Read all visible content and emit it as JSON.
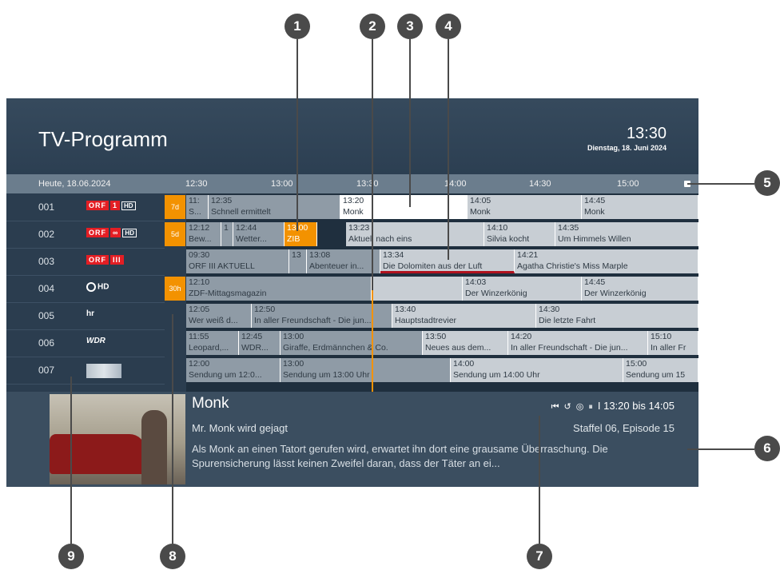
{
  "header": {
    "title": "TV-Programm",
    "clock": "13:30",
    "date": "Dienstag, 18. Juni 2024"
  },
  "timeline": {
    "day": "Heute, 18.06.2024",
    "ticks": [
      "12:30",
      "13:00",
      "13:30",
      "14:00",
      "14:30",
      "15:00"
    ]
  },
  "channels": [
    {
      "num": "001",
      "logo_main": "ORF",
      "logo_extra": "1",
      "logo_hd": "HD",
      "replay": "7d"
    },
    {
      "num": "002",
      "logo_main": "ORF",
      "logo_extra": "∞",
      "logo_hd": "HD",
      "replay": "5d"
    },
    {
      "num": "003",
      "logo_main": "ORF",
      "logo_extra": "III",
      "logo_hd": "",
      "replay": ""
    },
    {
      "num": "004",
      "logo_main": "HD",
      "logo_extra": "",
      "logo_hd": "",
      "replay": "30h"
    },
    {
      "num": "005",
      "logo_main": "hr",
      "logo_extra": "",
      "logo_hd": "",
      "replay": ""
    },
    {
      "num": "006",
      "logo_main": "WDR",
      "logo_extra": "",
      "logo_hd": "",
      "replay": ""
    },
    {
      "num": "007",
      "logo_main": "",
      "logo_extra": "",
      "logo_hd": "",
      "replay": ""
    }
  ],
  "grid": {
    "rows": [
      [
        {
          "t": "11:",
          "n": "S...",
          "style": "past"
        },
        {
          "t": "12:35",
          "n": "Schnell ermittelt",
          "style": "past"
        },
        {
          "t": "13:20",
          "n": "Monk",
          "style": "sel"
        },
        {
          "t": "",
          "n": "",
          "style": "sel"
        },
        {
          "t": "14:05",
          "n": "Monk",
          "style": ""
        },
        {
          "t": "14:45",
          "n": "Monk",
          "style": ""
        }
      ],
      [
        {
          "t": "12:12",
          "n": "Bew...",
          "style": "past"
        },
        {
          "t": "1",
          "n": "",
          "style": "past"
        },
        {
          "t": "12:44",
          "n": "Wetter...",
          "style": "past"
        },
        {
          "t": "13:00",
          "n": "ZIB",
          "style": "orange"
        },
        {
          "t": "13:23",
          "n": "Aktuell nach eins",
          "style": ""
        },
        {
          "t": "14:10",
          "n": "Silvia kocht",
          "style": ""
        },
        {
          "t": "14:35",
          "n": "Um Himmels Willen",
          "style": ""
        }
      ],
      [
        {
          "t": "09:30",
          "n": "ORF III AKTUELL",
          "style": "past"
        },
        {
          "t": "13",
          "n": "",
          "style": "past"
        },
        {
          "t": "13:08",
          "n": "Abenteuer in...",
          "style": "past"
        },
        {
          "t": "13:34",
          "n": "Die Dolomiten aus der Luft",
          "style": "redline"
        },
        {
          "t": "14:21",
          "n": "Agatha Christie's Miss Marple",
          "style": ""
        }
      ],
      [
        {
          "t": "12:10",
          "n": "ZDF-Mittagsmagazin",
          "style": "past"
        },
        {
          "t": "14:03",
          "n": "Der Winzerkönig",
          "style": ""
        },
        {
          "t": "14:45",
          "n": "Der Winzerkönig",
          "style": ""
        }
      ],
      [
        {
          "t": "12:05",
          "n": "Wer weiß d...",
          "style": "past"
        },
        {
          "t": "12:50",
          "n": "In aller Freundschaft - Die jun...",
          "style": "past"
        },
        {
          "t": "13:40",
          "n": "Hauptstadtrevier",
          "style": ""
        },
        {
          "t": "14:30",
          "n": "Die letzte Fahrt",
          "style": ""
        }
      ],
      [
        {
          "t": "11:55",
          "n": "Leopard,...",
          "style": "past"
        },
        {
          "t": "12:45",
          "n": "WDR...",
          "style": "past"
        },
        {
          "t": "13:00",
          "n": "Giraffe, Erdmännchen & Co.",
          "style": "past"
        },
        {
          "t": "13:50",
          "n": "Neues aus dem...",
          "style": ""
        },
        {
          "t": "14:20",
          "n": "In aller Freundschaft - Die jun...",
          "style": ""
        },
        {
          "t": "15:10",
          "n": "In aller Fr",
          "style": ""
        }
      ],
      [
        {
          "t": "12:00",
          "n": "Sendung um 12:0...",
          "style": "past"
        },
        {
          "t": "13:00",
          "n": "Sendung um 13:00 Uhr",
          "style": "past"
        },
        {
          "t": "14:00",
          "n": "Sendung um 14:00 Uhr",
          "style": ""
        },
        {
          "t": "15:00",
          "n": "Sendung um 15",
          "style": ""
        }
      ]
    ]
  },
  "info": {
    "title": "Monk",
    "episode_title": "Mr. Monk wird gejagt",
    "description": "Als Monk an einen Tatort gerufen wird, erwartet ihn dort eine grausame Überraschung. Die Spurensicherung lässt keinen Zweifel daran, dass der Täter an ei...",
    "time": "I 13:20 bis 14:05",
    "season": "Staffel 06, Episode 15",
    "icons": [
      "skip-back-icon",
      "restart-icon",
      "record-icon",
      "pause-icon"
    ]
  },
  "callouts": [
    "1",
    "2",
    "3",
    "4",
    "5",
    "6",
    "7",
    "8",
    "9"
  ],
  "colors": {
    "accent": "#f39200",
    "progress": "#b0121e",
    "badge": "#4a4a4a"
  }
}
